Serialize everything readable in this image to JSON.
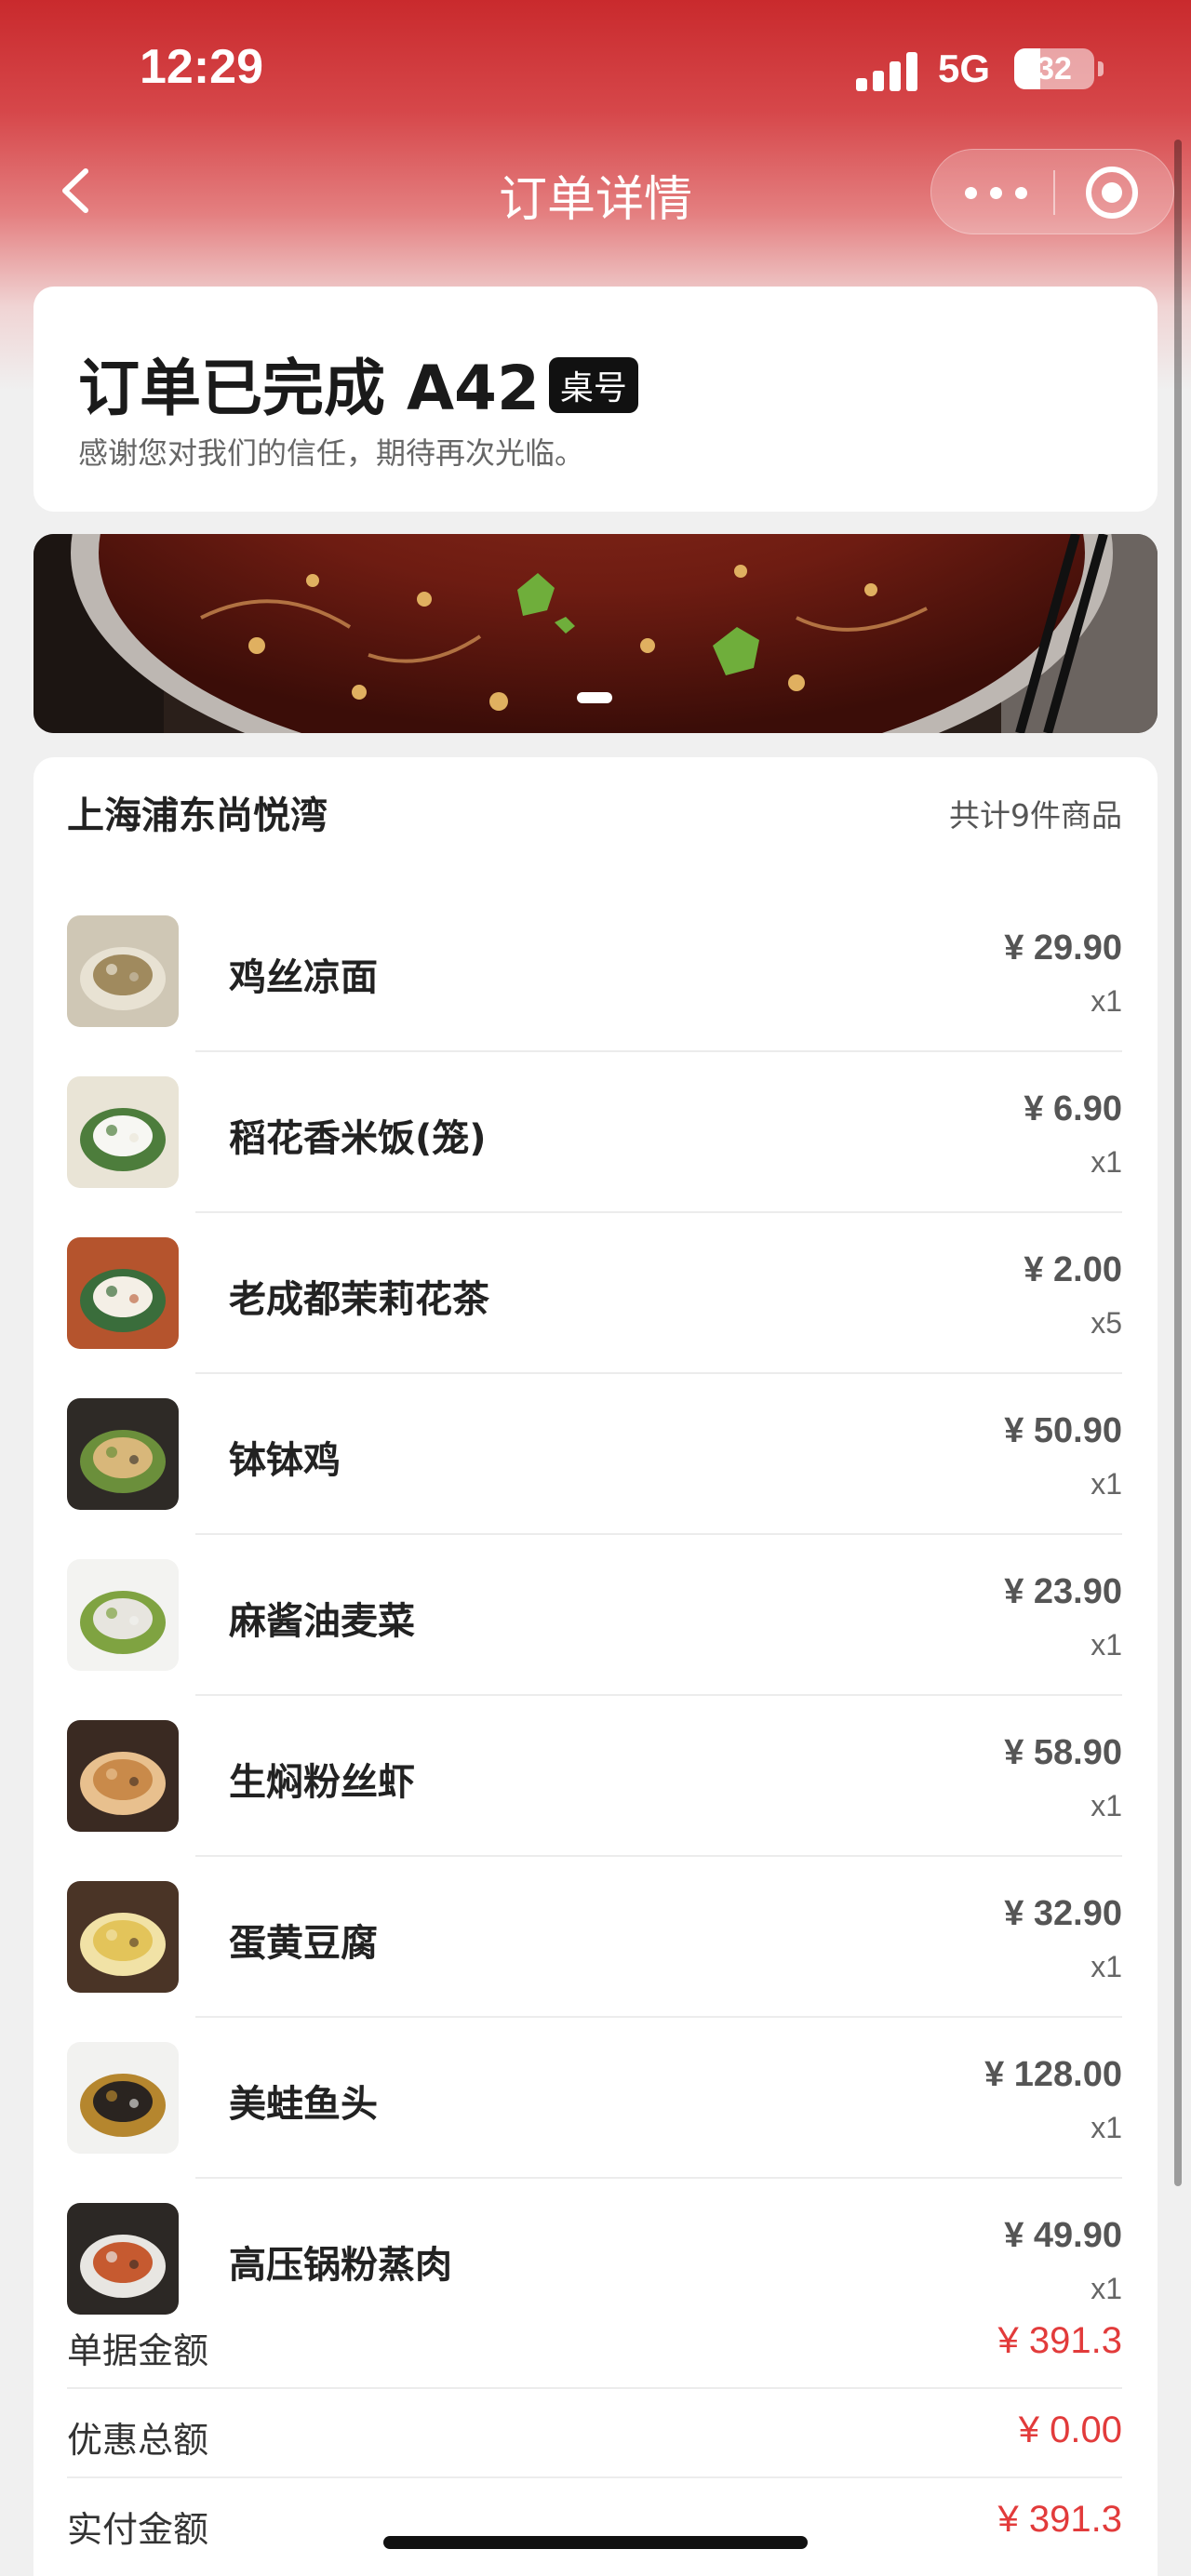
{
  "status_bar": {
    "time": "12:29",
    "network": "5G",
    "battery": "32",
    "battery_level": 0.32
  },
  "nav": {
    "title": "订单详情",
    "back_icon": "chevron-left-icon",
    "more_icon": "more-icon",
    "mini_program_icon": "target-icon"
  },
  "order_status": {
    "title": "订单已完成 A42",
    "badge": "桌号",
    "subtitle": "感谢您对我们的信任，期待再次光临。"
  },
  "banner": {
    "image": "hotpot-dish-photo",
    "active_slide": 1
  },
  "store": {
    "name": "上海浦东尚悦湾",
    "item_count": "共计9件商品"
  },
  "items": [
    {
      "name": "鸡丝凉面",
      "price": "¥ 29.90",
      "qty": "x1",
      "colors": [
        "#cfc7b5",
        "#a08a5e",
        "#e8e2d3"
      ]
    },
    {
      "name": "稻花香米饭(笼)",
      "price": "¥ 6.90",
      "qty": "x1",
      "colors": [
        "#e9e4d6",
        "#f7f7f3",
        "#4d7d3c"
      ]
    },
    {
      "name": "老成都茉莉花茶",
      "price": "¥ 2.00",
      "qty": "x5",
      "colors": [
        "#b5542d",
        "#f4efe6",
        "#3a6d3b"
      ]
    },
    {
      "name": "钵钵鸡",
      "price": "¥ 50.90",
      "qty": "x1",
      "colors": [
        "#2e2a26",
        "#d8b77a",
        "#6b8f3b"
      ]
    },
    {
      "name": "麻酱油麦菜",
      "price": "¥ 23.90",
      "qty": "x1",
      "colors": [
        "#f3f3f1",
        "#e7e5df",
        "#7fa341"
      ]
    },
    {
      "name": "生焖粉丝虾",
      "price": "¥ 58.90",
      "qty": "x1",
      "colors": [
        "#3a2a22",
        "#c98a4a",
        "#e8c08e"
      ]
    },
    {
      "name": "蛋黄豆腐",
      "price": "¥ 32.90",
      "qty": "x1",
      "colors": [
        "#4a3426",
        "#e3c45a",
        "#f1e2a6"
      ]
    },
    {
      "name": "美蛙鱼头",
      "price": "¥ 128.00",
      "qty": "x1",
      "colors": [
        "#f2f2f0",
        "#2a2420",
        "#b5862e"
      ]
    },
    {
      "name": "高压锅粉蒸肉",
      "price": "¥ 49.90",
      "qty": "x1",
      "colors": [
        "#2c2825",
        "#c65a30",
        "#e8e6e2"
      ]
    }
  ],
  "summary": [
    {
      "label": "单据金额",
      "value": "¥ 391.3"
    },
    {
      "label": "优惠总额",
      "value": "¥ 0.00"
    },
    {
      "label": "实付金额",
      "value": "¥ 391.3"
    }
  ],
  "colors": {
    "header_red": "#c92a2d",
    "price_red": "#e23b3b",
    "page_bg": "#f0f0f0"
  }
}
